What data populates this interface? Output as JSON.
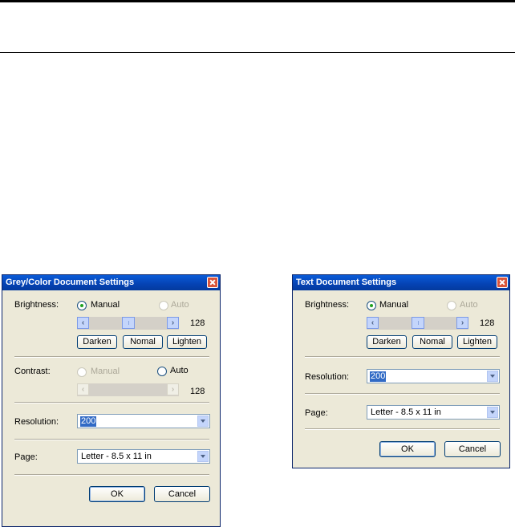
{
  "dialogs": {
    "grey": {
      "title": "Grey/Color Document Settings",
      "brightness": {
        "label": "Brightness:",
        "manual": "Manual",
        "auto": "Auto",
        "value": "128",
        "darken": "Darken",
        "normal": "Nomal",
        "lighten": "Lighten"
      },
      "contrast": {
        "label": "Contrast:",
        "manual": "Manual",
        "auto": "Auto",
        "value": "128"
      },
      "resolution": {
        "label": "Resolution:",
        "value": "200"
      },
      "page": {
        "label": "Page:",
        "value": "Letter - 8.5 x 11 in"
      },
      "ok": "OK",
      "cancel": "Cancel"
    },
    "text": {
      "title": "Text Document Settings",
      "brightness": {
        "label": "Brightness:",
        "manual": "Manual",
        "auto": "Auto",
        "value": "128",
        "darken": "Darken",
        "normal": "Nomal",
        "lighten": "Lighten"
      },
      "resolution": {
        "label": "Resolution:",
        "value": "200"
      },
      "page": {
        "label": "Page:",
        "value": "Letter - 8.5 x 11 in"
      },
      "ok": "OK",
      "cancel": "Cancel"
    }
  }
}
